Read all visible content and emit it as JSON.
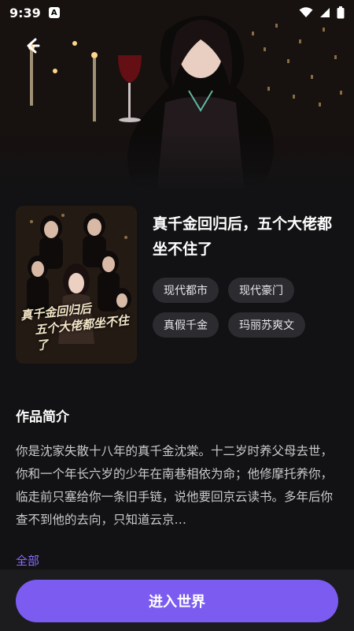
{
  "status_bar": {
    "time": "9:39",
    "badge": "A"
  },
  "book": {
    "title": "真千金回归后，五个大佬都坐不住了",
    "cover_caption_line1": "真千金回归后",
    "cover_caption_line2": "五个大佬都坐不住了",
    "tags": [
      "现代都市",
      "现代豪门",
      "真假千金",
      "玛丽苏爽文"
    ]
  },
  "intro": {
    "heading": "作品简介",
    "text": "你是沈家失散十八年的真千金沈棠。十二岁时养父母去世，你和一个年长六岁的少年在南巷相依为命；他修摩托养你，临走前只塞给你一条旧手链，说他要回京云读书。多年后你查不到他的去向，只知道云京…",
    "more_label": "全部"
  },
  "actions": {
    "enter_label": "进入世界"
  },
  "colors": {
    "accent": "#7c5cf0",
    "link": "#8b6bff",
    "background": "#121214"
  }
}
